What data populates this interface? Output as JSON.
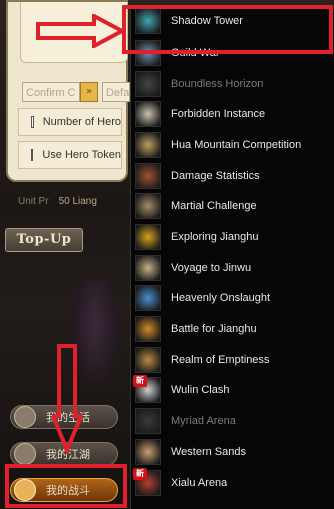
{
  "panel": {
    "combo_confirm": "Confirm C",
    "combo_default": "Defa",
    "option_hero_number": "Number of Hero",
    "option_hero_token": "Use Hero Token",
    "unit_label": "Unit Pr",
    "unit_value": "50 Liang"
  },
  "topup_label": "Top-Up",
  "side_buttons": [
    {
      "label": "我的生活"
    },
    {
      "label": "我的江湖"
    },
    {
      "label": "我的战斗"
    }
  ],
  "menu": {
    "items": [
      {
        "label": "Shadow Tower",
        "icon": "tower-icon",
        "enabled": true,
        "new": false,
        "color": "#3fa7b0"
      },
      {
        "label": "Guild War",
        "icon": "guild-war-icon",
        "enabled": true,
        "new": false,
        "color": "#6f8fb5"
      },
      {
        "label": "Boundless Horizon",
        "icon": "gate-icon",
        "enabled": false,
        "new": false,
        "color": "#444444"
      },
      {
        "label": "Forbidden Instance",
        "icon": "mahjong-tile-icon",
        "enabled": true,
        "new": false,
        "color": "#c9c2ad"
      },
      {
        "label": "Hua Mountain Competition",
        "icon": "buddha-icon",
        "enabled": true,
        "new": false,
        "color": "#b7a060"
      },
      {
        "label": "Damage Statistics",
        "icon": "book-icon",
        "enabled": true,
        "new": false,
        "color": "#a0522d"
      },
      {
        "label": "Martial Challenge",
        "icon": "crossed-swords-icon",
        "enabled": true,
        "new": false,
        "color": "#a58a6a"
      },
      {
        "label": "Exploring Jianghu",
        "icon": "flag-icon",
        "enabled": true,
        "new": false,
        "color": "#d4a21a"
      },
      {
        "label": "Voyage to Jinwu",
        "icon": "ship-icon",
        "enabled": true,
        "new": false,
        "color": "#c8b088"
      },
      {
        "label": "Heavenly Onslaught",
        "icon": "sword-orb-icon",
        "enabled": true,
        "new": false,
        "color": "#4a8fd0"
      },
      {
        "label": "Battle for Jianghu",
        "icon": "helmet-icon",
        "enabled": true,
        "new": false,
        "color": "#d08a2a"
      },
      {
        "label": "Realm of Emptiness",
        "icon": "realm-icon",
        "enabled": true,
        "new": false,
        "color": "#b98a40"
      },
      {
        "label": "Wulin Clash",
        "icon": "fighter-icon",
        "enabled": true,
        "new": true,
        "color": "#d0d0d0"
      },
      {
        "label": "Myriad Arena",
        "icon": "arena-icon",
        "enabled": false,
        "new": false,
        "color": "#3a3a3a"
      },
      {
        "label": "Western Sands",
        "icon": "camel-icon",
        "enabled": true,
        "new": false,
        "color": "#c8a070"
      },
      {
        "label": "Xialu Arena",
        "icon": "warrior-icon",
        "enabled": true,
        "new": true,
        "color": "#b04030"
      }
    ],
    "new_tag": "新"
  },
  "highlight_color": "#e0202a"
}
